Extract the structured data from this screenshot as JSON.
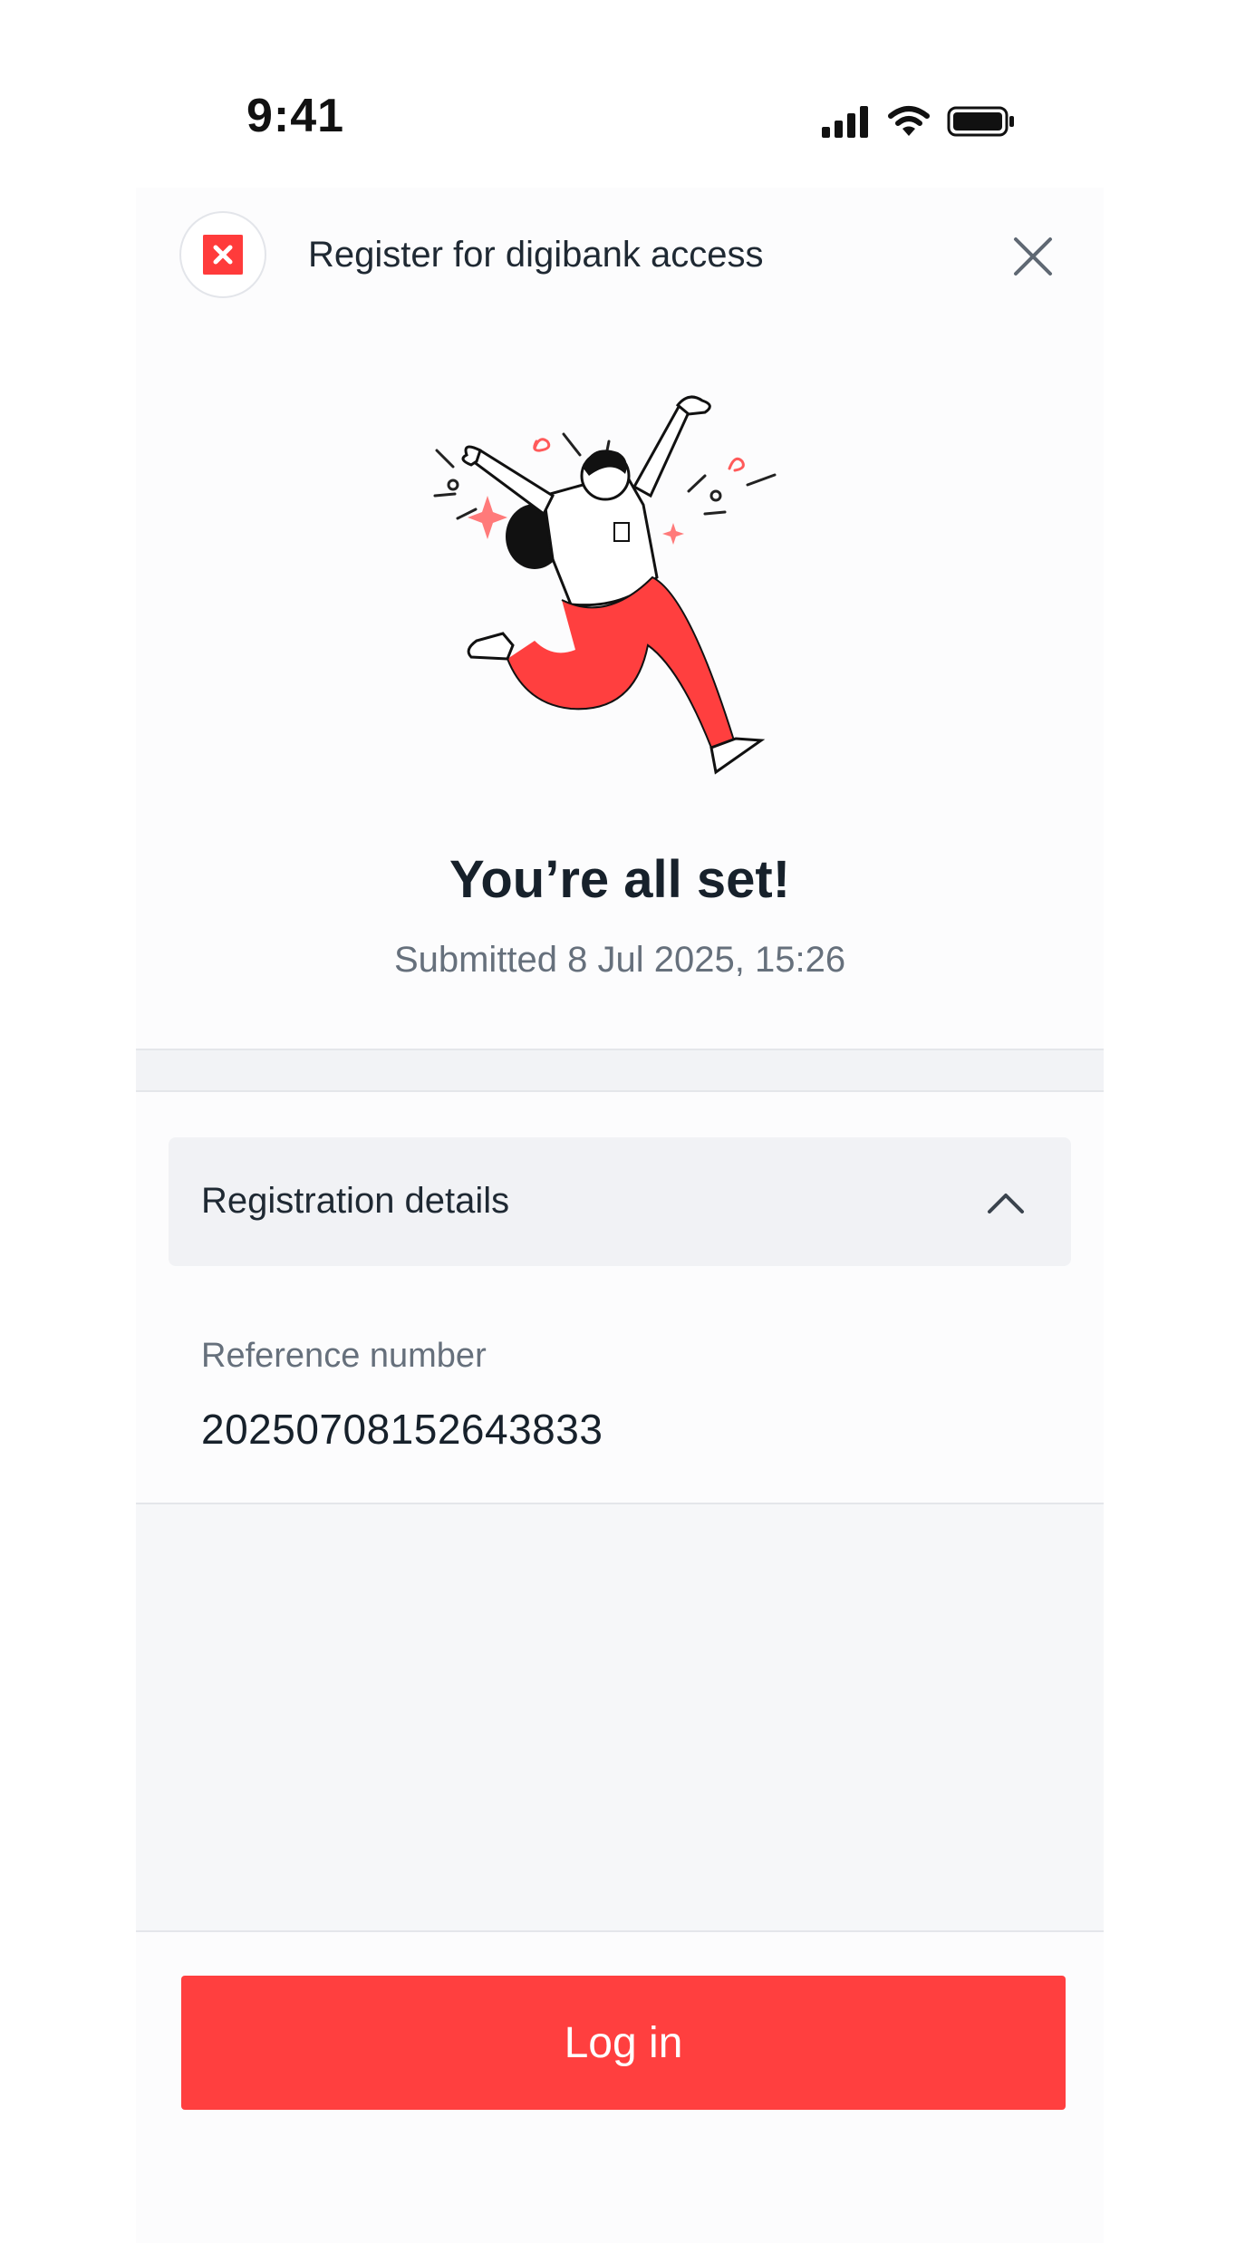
{
  "status_bar": {
    "time": "9:41",
    "icons": [
      "cellular-signal-icon",
      "wifi-icon",
      "battery-icon"
    ]
  },
  "header": {
    "logo_icon": "dbs-logo-icon",
    "title": "Register for digibank access",
    "close_icon": "close-icon"
  },
  "hero": {
    "illustration": "celebrating-person-illustration",
    "title": "You’re all set!",
    "submitted": "Submitted 8 Jul 2025, 15:26"
  },
  "details": {
    "section_title": "Registration details",
    "expanded": true,
    "reference_label": "Reference number",
    "reference_value": "20250708152643833"
  },
  "footer": {
    "login_label": "Log in"
  },
  "colors": {
    "brand_red": "#ff3f3f",
    "text_dark": "#17212b",
    "text_muted": "#66707c",
    "background": "#fcfcfd",
    "band": "#f2f3f6"
  }
}
